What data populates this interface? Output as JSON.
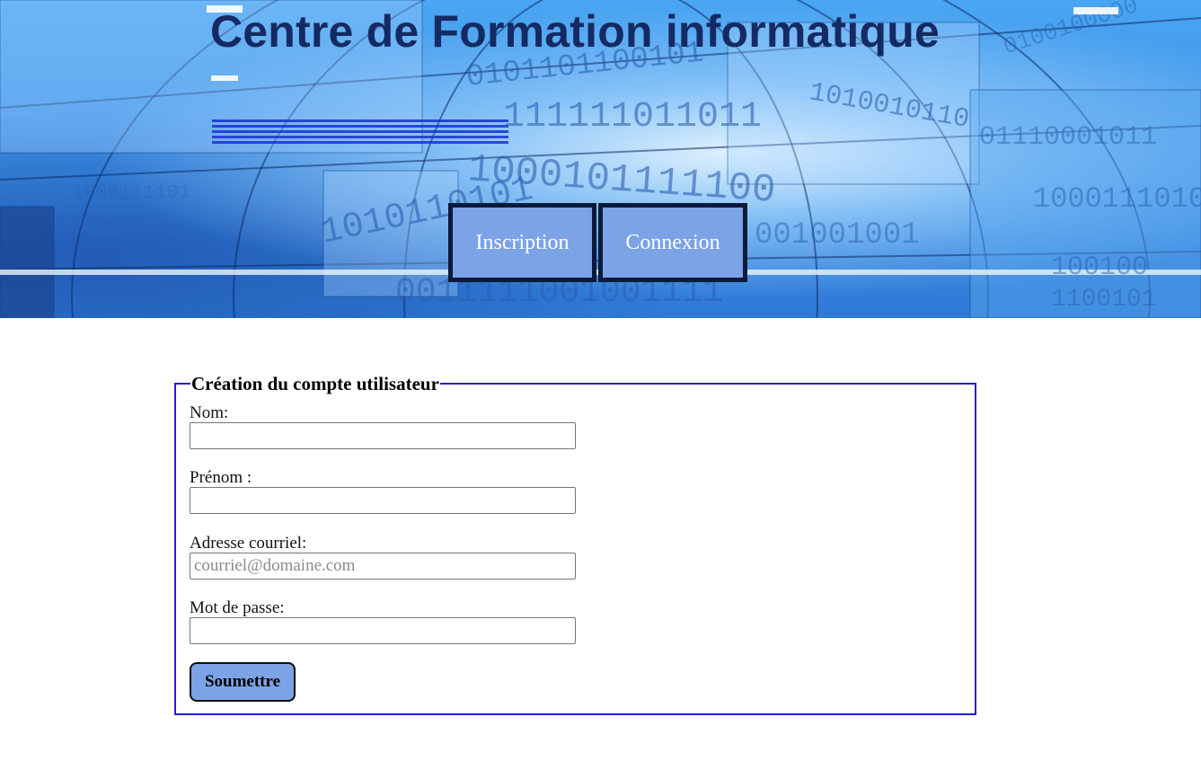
{
  "header": {
    "title": "Centre de Formation informatique",
    "background_image": "binary-data-globe-photo"
  },
  "nav": {
    "inscription_label": "Inscription",
    "connexion_label": "Connexion"
  },
  "form": {
    "legend": "Création du compte utilisateur",
    "fields": [
      {
        "label": "Nom:",
        "value": "",
        "placeholder": ""
      },
      {
        "label": "Prénom :",
        "value": "",
        "placeholder": ""
      },
      {
        "label": "Adresse courriel:",
        "value": "",
        "placeholder": "courriel@domaine.com"
      },
      {
        "label": "Mot de passe:",
        "value": "",
        "placeholder": ""
      }
    ],
    "submit_label": "Soumettre"
  },
  "colors": {
    "title": "#152a63",
    "button_fill": "#7ba3e6",
    "button_border": "#0c1a3a",
    "fieldset_border": "#2a1bd1"
  }
}
